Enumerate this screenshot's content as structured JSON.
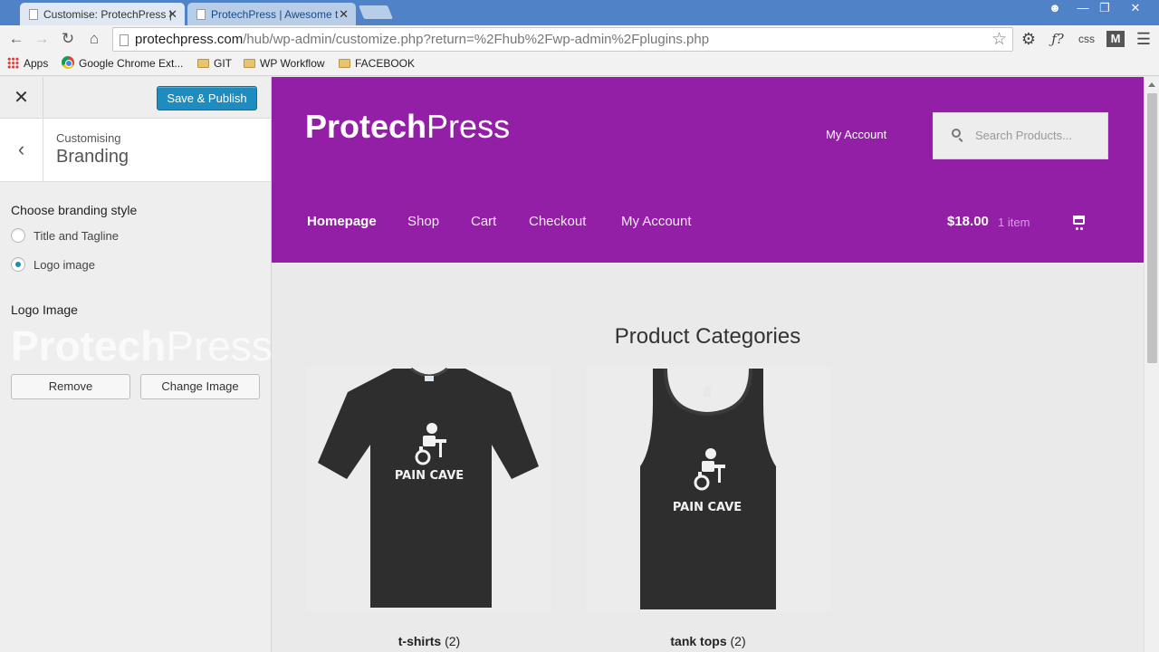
{
  "browser": {
    "tabs": [
      {
        "title": "Customise: ProtechPress |",
        "active": true
      },
      {
        "title": "ProtechPress | Awesome t",
        "active": false
      }
    ],
    "url_host": "protechpress.com",
    "url_path": "/hub/wp-admin/customize.php?return=%2Fhub%2Fwp-admin%2Fplugins.php",
    "extensions": [
      "gear-icon",
      "f-icon",
      "css",
      "m-icon",
      "menu-icon"
    ],
    "extension_labels": {
      "f": "ƒ?",
      "css": "css",
      "m": "M"
    },
    "bookmarks": [
      {
        "label": "Apps",
        "icon": "apps-icon"
      },
      {
        "label": "Google Chrome Ext...",
        "icon": "chrome-icon"
      },
      {
        "label": "GIT",
        "icon": "folder-icon"
      },
      {
        "label": "WP Workflow",
        "icon": "folder-icon"
      },
      {
        "label": "FACEBOOK",
        "icon": "folder-icon"
      }
    ]
  },
  "customizer": {
    "save_label": "Save & Publish",
    "breadcrumb": "Customising",
    "section_title": "Branding",
    "branding_style_label": "Choose branding style",
    "options": [
      {
        "label": "Title and Tagline",
        "checked": false
      },
      {
        "label": "Logo image",
        "checked": true
      }
    ],
    "logo_image_label": "Logo Image",
    "logo_preview_bold": "Protech",
    "logo_preview_light": "Press",
    "remove_label": "Remove",
    "change_label": "Change Image",
    "accent_color": "#1e8cbe"
  },
  "site": {
    "logo_bold": "Protech",
    "logo_light": "Press",
    "header_account": "My Account",
    "search_placeholder": "Search Products...",
    "nav": [
      "Homepage",
      "Shop",
      "Cart",
      "Checkout",
      "My Account"
    ],
    "cart_total": "$18.00",
    "cart_count": "1 item",
    "header_color": "#931fa6",
    "categories_title": "Product Categories",
    "products": [
      {
        "name": "t-shirts",
        "count": "(2)",
        "print": "PAIN CAVE"
      },
      {
        "name": "tank tops",
        "count": "(2)",
        "print": "PAIN CAVE"
      }
    ]
  }
}
